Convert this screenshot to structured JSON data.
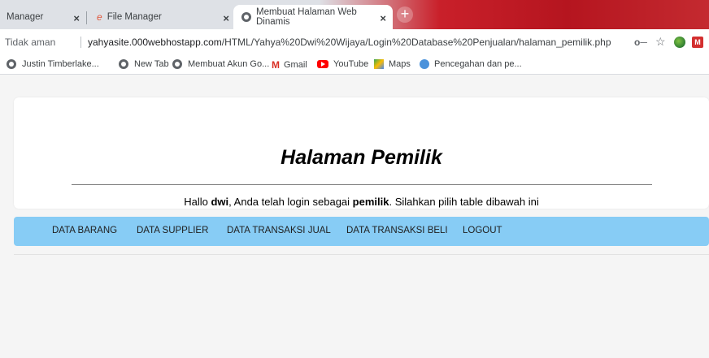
{
  "browser": {
    "tabs": [
      {
        "label": "Manager"
      },
      {
        "label": "File Manager"
      },
      {
        "label": "Membuat Halaman Web Dinamis"
      }
    ],
    "new_tab_symbol": "+",
    "close_symbol": "×",
    "address": {
      "security_label": "Tidak aman",
      "url_host": "yahyasite.000webhostapp.com",
      "url_path": "/HTML/Yahya%20Dwi%20Wijaya/Login%20Database%20Penjualan/halaman_pemilik.php"
    },
    "bookmarks": [
      {
        "label": "Justin Timberlake...",
        "icon": "globe-icon"
      },
      {
        "label": "New Tab",
        "icon": "globe-icon"
      },
      {
        "label": "Membuat Akun Go...",
        "icon": "globe-icon"
      },
      {
        "label": "Gmail",
        "icon": "gmail-icon"
      },
      {
        "label": "YouTube",
        "icon": "youtube-icon"
      },
      {
        "label": "Maps",
        "icon": "maps-icon"
      },
      {
        "label": "Pencegahan dan pe...",
        "icon": "un-icon"
      }
    ]
  },
  "page": {
    "title": "Halaman Pemilik",
    "greeting": {
      "prefix": "Hallo ",
      "user": "dwi",
      "middle": ", Anda telah login sebagai ",
      "role": "pemilik",
      "suffix": ". Silahkan pilih table dibawah ini"
    },
    "nav": [
      {
        "label": "DATA BARANG"
      },
      {
        "label": "DATA SUPPLIER"
      },
      {
        "label": "DATA TRANSAKSI JUAL"
      },
      {
        "label": "DATA TRANSAKSI BELI"
      },
      {
        "label": "LOGOUT"
      }
    ]
  },
  "colors": {
    "nav_bg": "#87ccf5",
    "tabstrip_accent": "#c9202a"
  }
}
